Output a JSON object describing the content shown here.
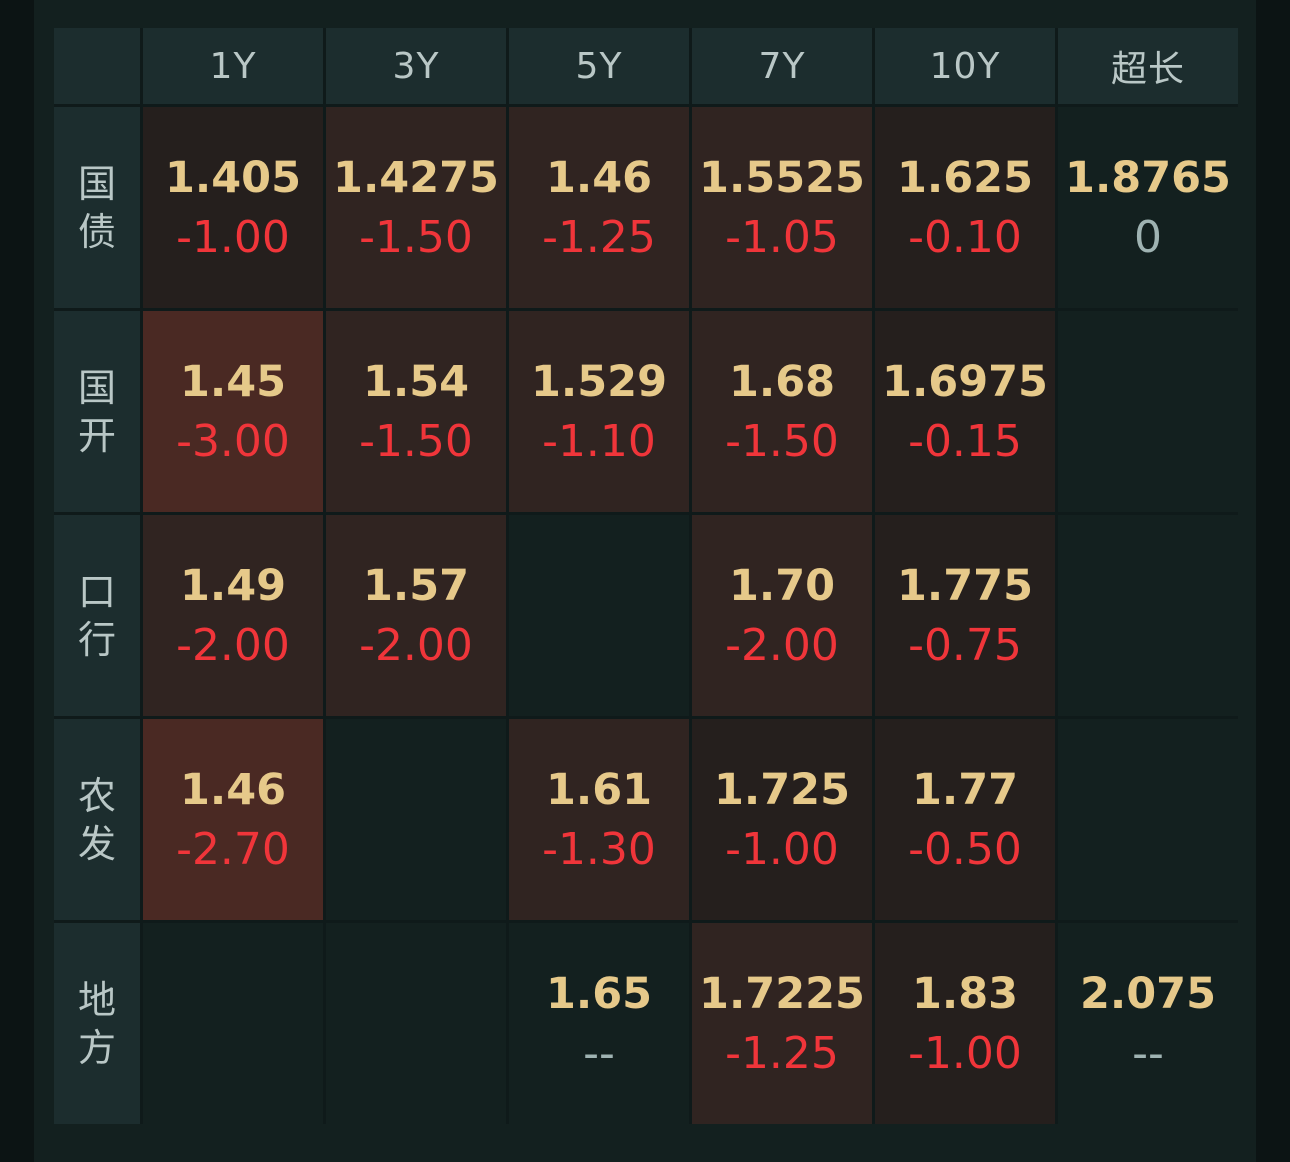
{
  "columns": [
    "1Y",
    "3Y",
    "5Y",
    "7Y",
    "10Y",
    "超长"
  ],
  "colors": {
    "neutral": "#13201f",
    "light": "#251f1d",
    "medium": "#302421",
    "strong": "#4a2923",
    "yield_text": "#e6c98a",
    "negative_text": "#f0353a",
    "zero_text": "#9fb3b2"
  },
  "rows": [
    {
      "label": [
        "国",
        "债"
      ],
      "cells": [
        {
          "yield": "1.405",
          "change": "-1.00",
          "tone": "light"
        },
        {
          "yield": "1.4275",
          "change": "-1.50",
          "tone": "medium"
        },
        {
          "yield": "1.46",
          "change": "-1.25",
          "tone": "medium"
        },
        {
          "yield": "1.5525",
          "change": "-1.05",
          "tone": "medium"
        },
        {
          "yield": "1.625",
          "change": "-0.10",
          "tone": "light"
        },
        {
          "yield": "1.8765",
          "change": "0",
          "tone": "neutral"
        }
      ]
    },
    {
      "label": [
        "国",
        "开"
      ],
      "cells": [
        {
          "yield": "1.45",
          "change": "-3.00",
          "tone": "strong"
        },
        {
          "yield": "1.54",
          "change": "-1.50",
          "tone": "medium"
        },
        {
          "yield": "1.529",
          "change": "-1.10",
          "tone": "medium"
        },
        {
          "yield": "1.68",
          "change": "-1.50",
          "tone": "medium"
        },
        {
          "yield": "1.6975",
          "change": "-0.15",
          "tone": "light"
        },
        null
      ]
    },
    {
      "label": [
        "口",
        "行"
      ],
      "cells": [
        {
          "yield": "1.49",
          "change": "-2.00",
          "tone": "medium"
        },
        {
          "yield": "1.57",
          "change": "-2.00",
          "tone": "medium"
        },
        null,
        {
          "yield": "1.70",
          "change": "-2.00",
          "tone": "medium"
        },
        {
          "yield": "1.775",
          "change": "-0.75",
          "tone": "light"
        },
        null
      ]
    },
    {
      "label": [
        "农",
        "发"
      ],
      "cells": [
        {
          "yield": "1.46",
          "change": "-2.70",
          "tone": "strong"
        },
        null,
        {
          "yield": "1.61",
          "change": "-1.30",
          "tone": "medium"
        },
        {
          "yield": "1.725",
          "change": "-1.00",
          "tone": "light"
        },
        {
          "yield": "1.77",
          "change": "-0.50",
          "tone": "light"
        },
        null
      ]
    },
    {
      "label": [
        "地",
        "方"
      ],
      "cells": [
        null,
        null,
        {
          "yield": "1.65",
          "change": "--",
          "tone": "neutral"
        },
        {
          "yield": "1.7225",
          "change": "-1.25",
          "tone": "medium"
        },
        {
          "yield": "1.83",
          "change": "-1.00",
          "tone": "light"
        },
        {
          "yield": "2.075",
          "change": "--",
          "tone": "neutral"
        }
      ]
    }
  ]
}
